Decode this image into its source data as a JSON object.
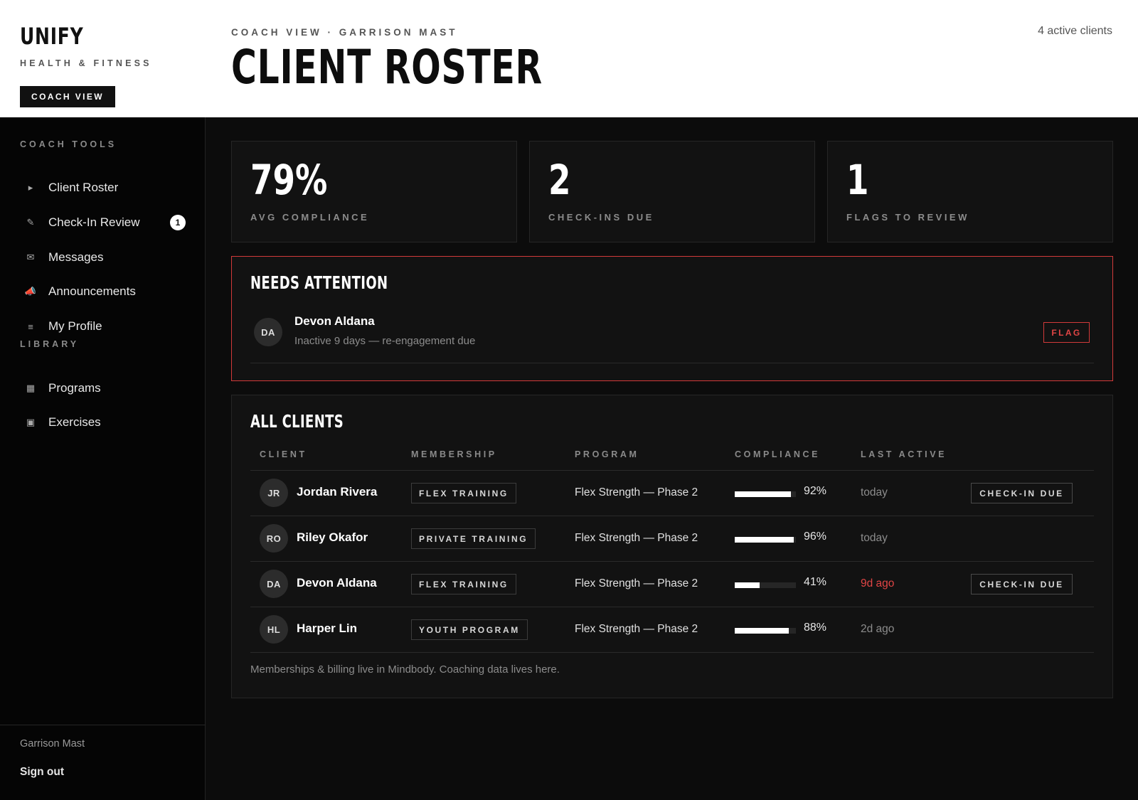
{
  "brand": {
    "name": "UNIFY",
    "tagline": "HEALTH & FITNESS",
    "mode_pill": "COACH VIEW"
  },
  "header": {
    "eyebrow": "COACH VIEW · GARRISON MAST",
    "title": "CLIENT ROSTER",
    "active_clients": "4 active clients"
  },
  "sidebar": {
    "sections": [
      {
        "heading": "COACH TOOLS",
        "items": [
          {
            "label": "Client Roster",
            "icon": "play-arrow-icon",
            "glyph": "▸",
            "badge": ""
          },
          {
            "label": "Check-In Review",
            "icon": "pencil-icon",
            "glyph": "✎",
            "badge": "1"
          },
          {
            "label": "Messages",
            "icon": "envelope-icon",
            "glyph": "✉",
            "badge": ""
          },
          {
            "label": "Announcements",
            "icon": "megaphone-icon",
            "glyph": "📣",
            "badge": ""
          },
          {
            "label": "My Profile",
            "icon": "menu-lines-icon",
            "glyph": "≡",
            "badge": ""
          }
        ]
      },
      {
        "heading": "LIBRARY",
        "items": [
          {
            "label": "Programs",
            "icon": "grid-icon",
            "glyph": "▦",
            "badge": ""
          },
          {
            "label": "Exercises",
            "icon": "square-icon",
            "glyph": "▣",
            "badge": ""
          }
        ]
      }
    ],
    "footer": {
      "user": "Garrison Mast",
      "sign_out": "Sign out"
    }
  },
  "stats": [
    {
      "value": "79%",
      "label": "AVG COMPLIANCE"
    },
    {
      "value": "2",
      "label": "CHECK-INS DUE"
    },
    {
      "value": "1",
      "label": "FLAGS TO REVIEW"
    }
  ],
  "attention": {
    "title": "NEEDS ATTENTION",
    "items": [
      {
        "initials": "DA",
        "name": "Devon Aldana",
        "detail": "Inactive 9 days — re-engagement due",
        "action": "FLAG"
      }
    ]
  },
  "clients": {
    "title": "ALL CLIENTS",
    "columns": [
      "CLIENT",
      "MEMBERSHIP",
      "PROGRAM",
      "COMPLIANCE",
      "LAST ACTIVE"
    ],
    "rows": [
      {
        "initials": "JR",
        "name": "Jordan Rivera",
        "membership": "FLEX TRAINING",
        "program": "Flex Strength — Phase 2",
        "compliance": 0.92,
        "compliance_label": "92%",
        "last_active": "today",
        "stale": false,
        "action": "CHECK-IN DUE"
      },
      {
        "initials": "RO",
        "name": "Riley Okafor",
        "membership": "PRIVATE TRAINING",
        "program": "Flex Strength — Phase 2",
        "compliance": 0.96,
        "compliance_label": "96%",
        "last_active": "today",
        "stale": false,
        "action": ""
      },
      {
        "initials": "DA",
        "name": "Devon Aldana",
        "membership": "FLEX TRAINING",
        "program": "Flex Strength — Phase 2",
        "compliance": 0.41,
        "compliance_label": "41%",
        "last_active": "9d ago",
        "stale": true,
        "action": "CHECK-IN DUE"
      },
      {
        "initials": "HL",
        "name": "Harper Lin",
        "membership": "YOUTH PROGRAM",
        "program": "Flex Strength — Phase 2",
        "compliance": 0.88,
        "compliance_label": "88%",
        "last_active": "2d ago",
        "stale": false,
        "action": ""
      }
    ],
    "note": "Memberships & billing live in Mindbody. Coaching data lives here."
  },
  "colors": {
    "accent_red": "#d23a3a",
    "warn_text": "#e04545",
    "background": "#0c0c0c",
    "card": "#121212"
  }
}
